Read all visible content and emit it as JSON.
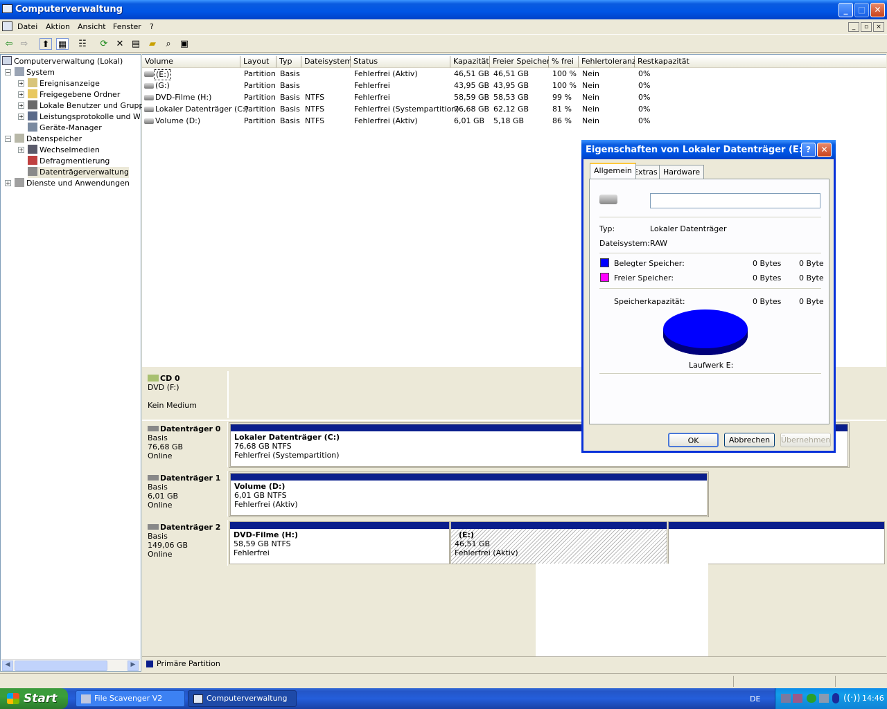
{
  "window": {
    "title": "Computerverwaltung"
  },
  "menu": [
    "Datei",
    "Aktion",
    "Ansicht",
    "Fenster",
    "?"
  ],
  "tree": {
    "root": "Computerverwaltung (Lokal)",
    "system": "System",
    "ereignis": "Ereignisanzeige",
    "freigabe": "Freigegebene Ordner",
    "benutzer": "Lokale Benutzer und Gruppen",
    "leistung": "Leistungsprotokolle und Warnungen",
    "geraete": "Geräte-Manager",
    "speicher": "Datenspeicher",
    "wechsel": "Wechselmedien",
    "defrag": "Defragmentierung",
    "dtv": "Datenträgerverwaltung",
    "dienste": "Dienste und Anwendungen"
  },
  "columns": [
    "Volume",
    "Layout",
    "Typ",
    "Dateisystem",
    "Status",
    "Kapazität",
    "Freier Speicher",
    "% frei",
    "Fehlertoleranz",
    "Restkapazität"
  ],
  "volumes": [
    [
      "(E:)",
      "Partition",
      "Basis",
      "",
      "Fehlerfrei (Aktiv)",
      "46,51 GB",
      "46,51 GB",
      "100 %",
      "Nein",
      "0%"
    ],
    [
      "(G:)",
      "Partition",
      "Basis",
      "",
      "Fehlerfrei",
      "43,95 GB",
      "43,95 GB",
      "100 %",
      "Nein",
      "0%"
    ],
    [
      "DVD-Filme (H:)",
      "Partition",
      "Basis",
      "NTFS",
      "Fehlerfrei",
      "58,59 GB",
      "58,53 GB",
      "99 %",
      "Nein",
      "0%"
    ],
    [
      "Lokaler Datenträger (C:)",
      "Partition",
      "Basis",
      "NTFS",
      "Fehlerfrei (Systempartition)",
      "76,68 GB",
      "62,12 GB",
      "81 %",
      "Nein",
      "0%"
    ],
    [
      "Volume (D:)",
      "Partition",
      "Basis",
      "NTFS",
      "Fehlerfrei (Aktiv)",
      "6,01 GB",
      "5,18 GB",
      "86 %",
      "Nein",
      "0%"
    ]
  ],
  "disks": {
    "cd0": {
      "name": "CD 0",
      "l1": "DVD (F:)",
      "l2": "Kein Medium"
    },
    "d0": {
      "name": "Datenträger 0",
      "l1": "Basis",
      "l2": "76,68 GB",
      "l3": "Online",
      "p1": {
        "name": "Lokaler Datenträger  (C:)",
        "size": "76,68 GB NTFS",
        "status": "Fehlerfrei (Systempartition)"
      }
    },
    "d1": {
      "name": "Datenträger 1",
      "l1": "Basis",
      "l2": "6,01 GB",
      "l3": "Online",
      "p1": {
        "name": "Volume  (D:)",
        "size": "6,01 GB NTFS",
        "status": "Fehlerfrei (Aktiv)"
      }
    },
    "d2": {
      "name": "Datenträger 2",
      "l1": "Basis",
      "l2": "149,06 GB",
      "l3": "Online",
      "p1": {
        "name": "DVD-Filme  (H:)",
        "size": "58,59 GB NTFS",
        "status": "Fehlerfrei"
      },
      "p2": {
        "name": "(E:)",
        "size": "46,51 GB",
        "status": "Fehlerfrei (Aktiv)"
      }
    }
  },
  "legend": "Primäre Partition",
  "dialog": {
    "title": "Eigenschaften von Lokaler Datenträger (E:)",
    "tabs": [
      "Allgemein",
      "Extras",
      "Hardware"
    ],
    "name_value": "",
    "typ_label": "Typ:",
    "typ_value": "Lokaler Datenträger",
    "fs_label": "Dateisystem:",
    "fs_value": "RAW",
    "used_label": "Belegter Speicher:",
    "used_bytes": "0 Bytes",
    "used_short": "0 Byte",
    "free_label": "Freier Speicher:",
    "free_bytes": "0 Bytes",
    "free_short": "0 Byte",
    "cap_label": "Speicherkapazität:",
    "cap_bytes": "0 Bytes",
    "cap_short": "0 Byte",
    "drive_label": "Laufwerk E:",
    "ok": "OK",
    "cancel": "Abbrechen",
    "apply": "Übernehmen",
    "used_color": "#0000ff",
    "free_color": "#ff00ff"
  },
  "taskbar": {
    "start": "Start",
    "task1": "File Scavenger V2",
    "task2": "Computerverwaltung",
    "lang": "DE",
    "clock": "14:46"
  }
}
